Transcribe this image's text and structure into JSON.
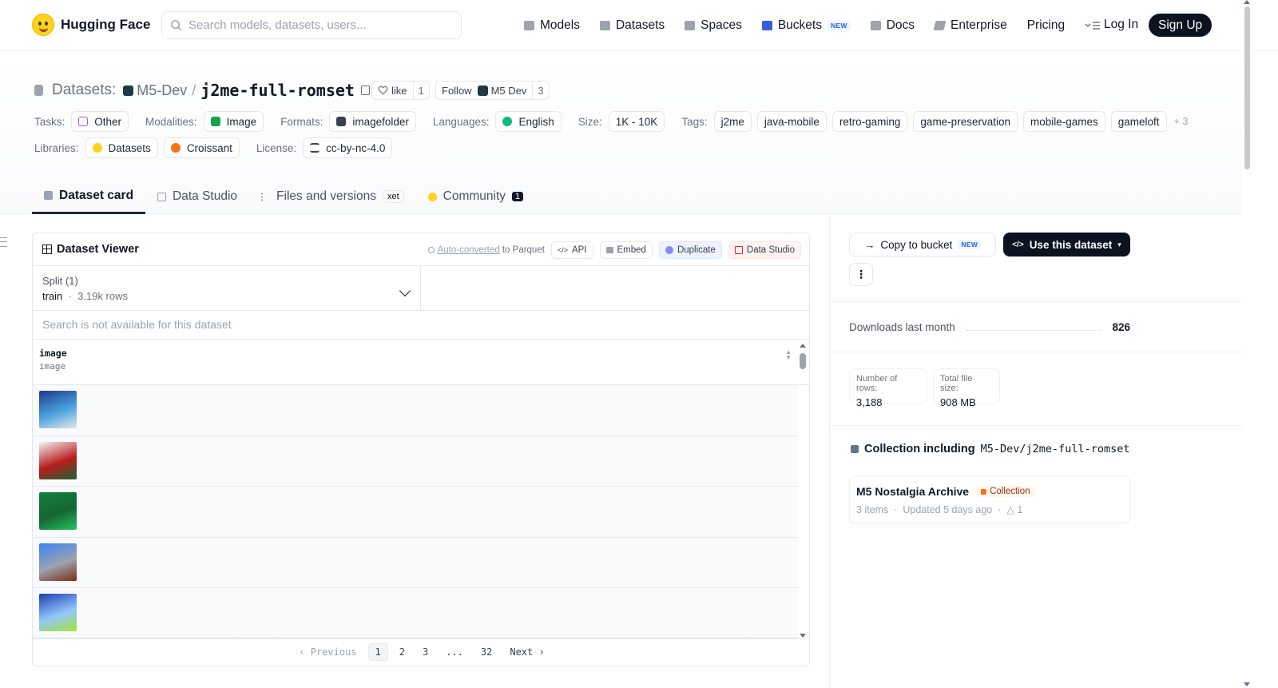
{
  "header": {
    "brand": "Hugging Face",
    "search_placeholder": "Search models, datasets, users...",
    "nav": [
      {
        "label": "Models",
        "icon": "cube-icon"
      },
      {
        "label": "Datasets",
        "icon": "database-icon"
      },
      {
        "label": "Spaces",
        "icon": "grid-icon"
      },
      {
        "label": "Buckets",
        "icon": "bucket-icon",
        "badge": "NEW"
      },
      {
        "label": "Docs",
        "icon": "book-icon"
      },
      {
        "label": "Enterprise",
        "icon": "enterprise-icon"
      },
      {
        "label": "Pricing"
      }
    ],
    "login": "Log In",
    "signup": "Sign Up"
  },
  "dataset": {
    "prefix": "Datasets:",
    "org": "M5-Dev",
    "name": "j2me-full-romset",
    "like_label": "like",
    "like_count": "1",
    "follow_label": "Follow",
    "follow_org": "M5 Dev",
    "follow_count": "3"
  },
  "meta": {
    "tasks_label": "Tasks:",
    "task": "Other",
    "modalities_label": "Modalities:",
    "modality": "Image",
    "formats_label": "Formats:",
    "format": "imagefolder",
    "languages_label": "Languages:",
    "language": "English",
    "size_label": "Size:",
    "size": "1K - 10K",
    "tags_label": "Tags:",
    "tags": [
      "j2me",
      "java-mobile",
      "retro-gaming",
      "game-preservation",
      "mobile-games",
      "gameloft"
    ],
    "tags_more": "+ 3",
    "libraries_label": "Libraries:",
    "libraries": [
      "Datasets",
      "Croissant"
    ],
    "license_label": "License:",
    "license": "cc-by-nc-4.0"
  },
  "tabs": [
    {
      "label": "Dataset card"
    },
    {
      "label": "Data Studio"
    },
    {
      "label": "Files and versions",
      "badge": "xet"
    },
    {
      "label": "Community",
      "badge": "1"
    }
  ],
  "viewer": {
    "title": "Dataset Viewer",
    "auto_converted": "Auto-converted",
    "to_parquet": "to Parquet",
    "api": "API",
    "embed": "Embed",
    "duplicate": "Duplicate",
    "data_studio": "Data Studio",
    "split_label": "Split (1)",
    "split_name": "train",
    "split_rows": "3.19k rows",
    "search_na": "Search is not available for this dataset",
    "column_name": "image",
    "column_type": "image",
    "thumb_colors": [
      [
        "#1e3a8a",
        "#4aa3df",
        "#e5e7eb"
      ],
      [
        "#f3f4f6",
        "#b91c1c",
        "#166534"
      ],
      [
        "#15803d",
        "#166534",
        "#22c55e"
      ],
      [
        "#3b82f6",
        "#9ca3af",
        "#7c2d12"
      ],
      [
        "#1e40af",
        "#93c5fd",
        "#a3e635"
      ]
    ],
    "pager": {
      "prev": "Previous",
      "pages": [
        "1",
        "2",
        "3",
        "...",
        "32"
      ],
      "next": "Next"
    }
  },
  "sidebar": {
    "copy_bucket": "Copy to bucket",
    "copy_badge": "NEW",
    "use_dataset": "Use this dataset",
    "downloads_label": "Downloads last month",
    "downloads": "826",
    "rows_label": "Number of rows:",
    "rows": "3,188",
    "filesize_label": "Total file size:",
    "filesize": "908 MB",
    "collection_heading": "Collection including",
    "collection_repo": "M5-Dev/j2me-full-romset",
    "collection_name": "M5 Nostalgia Archive",
    "collection_badge": "Collection",
    "collection_items": "3 items",
    "collection_updated": "Updated 5 days ago",
    "collection_upvotes": "1"
  },
  "colors": {
    "brand_yellow": "#ffd21e",
    "dark_button": "#0b1220",
    "new_badge": "#2563eb"
  }
}
